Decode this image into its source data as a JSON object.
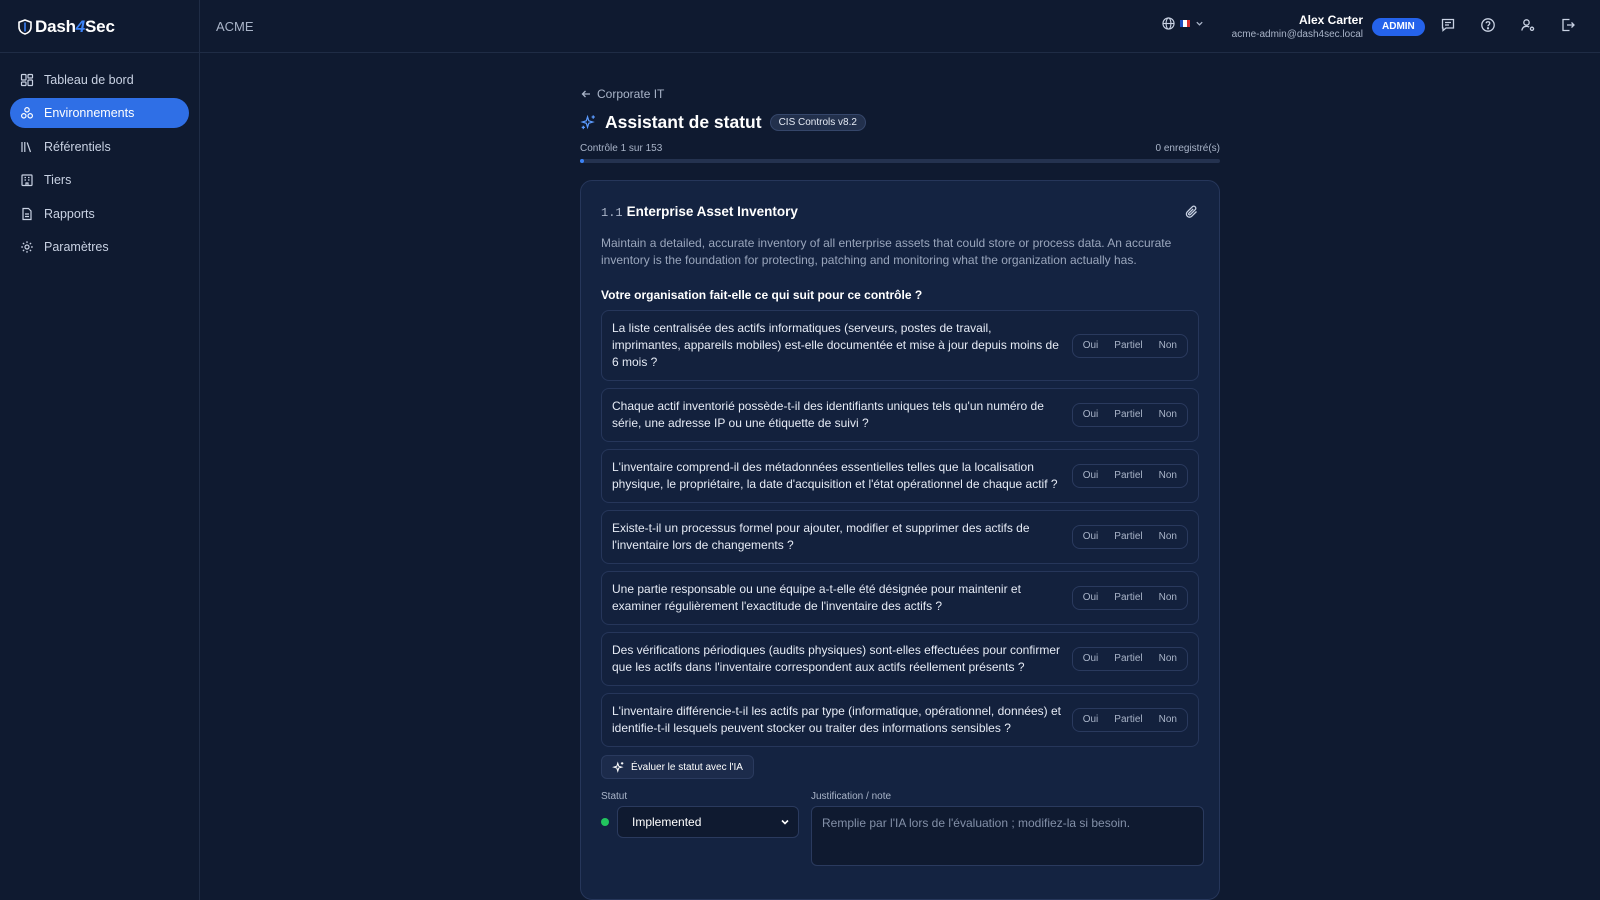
{
  "app": {
    "logo_left": "Dash",
    "logo_bolt": "4",
    "logo_right": "Sec"
  },
  "header": {
    "org": "ACME",
    "user_name": "Alex Carter",
    "user_email": "acme-admin@dash4sec.local",
    "role_badge": "ADMIN",
    "flag_colors": [
      "#1f4fbf",
      "#ffffff",
      "#d93030"
    ]
  },
  "sidebar": {
    "items": [
      {
        "label": "Tableau de bord",
        "icon": "dashboard-icon"
      },
      {
        "label": "Environnements",
        "icon": "environments-icon",
        "active": true
      },
      {
        "label": "Référentiels",
        "icon": "library-icon"
      },
      {
        "label": "Tiers",
        "icon": "building-icon"
      },
      {
        "label": "Rapports",
        "icon": "report-icon"
      },
      {
        "label": "Paramètres",
        "icon": "settings-icon"
      }
    ]
  },
  "main": {
    "back_label": "Corporate IT",
    "title": "Assistant de statut",
    "framework_badge": "CIS Controls v8.2",
    "progress_label": "Contrôle 1 sur 153",
    "saved_label": "0 enregistré(s)",
    "progress_fraction": 0.0065
  },
  "control": {
    "id": "1.1",
    "name": "Enterprise Asset Inventory",
    "description": "Maintain a detailed, accurate inventory of all enterprise assets that could store or process data. An accurate inventory is the foundation for protecting, patching and monitoring what the organization actually has.",
    "question_heading": "Votre organisation fait-elle ce qui suit pour ce contrôle ?",
    "answer_options": [
      "Oui",
      "Partiel",
      "Non"
    ],
    "questions": [
      "La liste centralisée des actifs informatiques (serveurs, postes de travail, imprimantes, appareils mobiles) est-elle documentée et mise à jour depuis moins de 6 mois ?",
      "Chaque actif inventorié possède-t-il des identifiants uniques tels qu'un numéro de série, une adresse IP ou une étiquette de suivi ?",
      "L'inventaire comprend-il des métadonnées essentielles telles que la localisation physique, le propriétaire, la date d'acquisition et l'état opérationnel de chaque actif ?",
      "Existe-t-il un processus formel pour ajouter, modifier et supprimer des actifs de l'inventaire lors de changements ?",
      "Une partie responsable ou une équipe a-t-elle été désignée pour maintenir et examiner régulièrement l'exactitude de l'inventaire des actifs ?",
      "Des vérifications périodiques (audits physiques) sont-elles effectuées pour confirmer que les actifs dans l'inventaire correspondent aux actifs réellement présents ?",
      "L'inventaire différencie-t-il les actifs par type (informatique, opérationnel, données) et identifie-t-il lesquels peuvent stocker ou traiter des informations sensibles ?"
    ],
    "ai_button": "Évaluer le statut avec l'IA",
    "status_label": "Statut",
    "status_value": "Implemented",
    "status_color": "#22c55e",
    "note_label": "Justification / note",
    "note_placeholder": "Remplie par l'IA lors de l'évaluation ; modifiez-la si besoin."
  }
}
